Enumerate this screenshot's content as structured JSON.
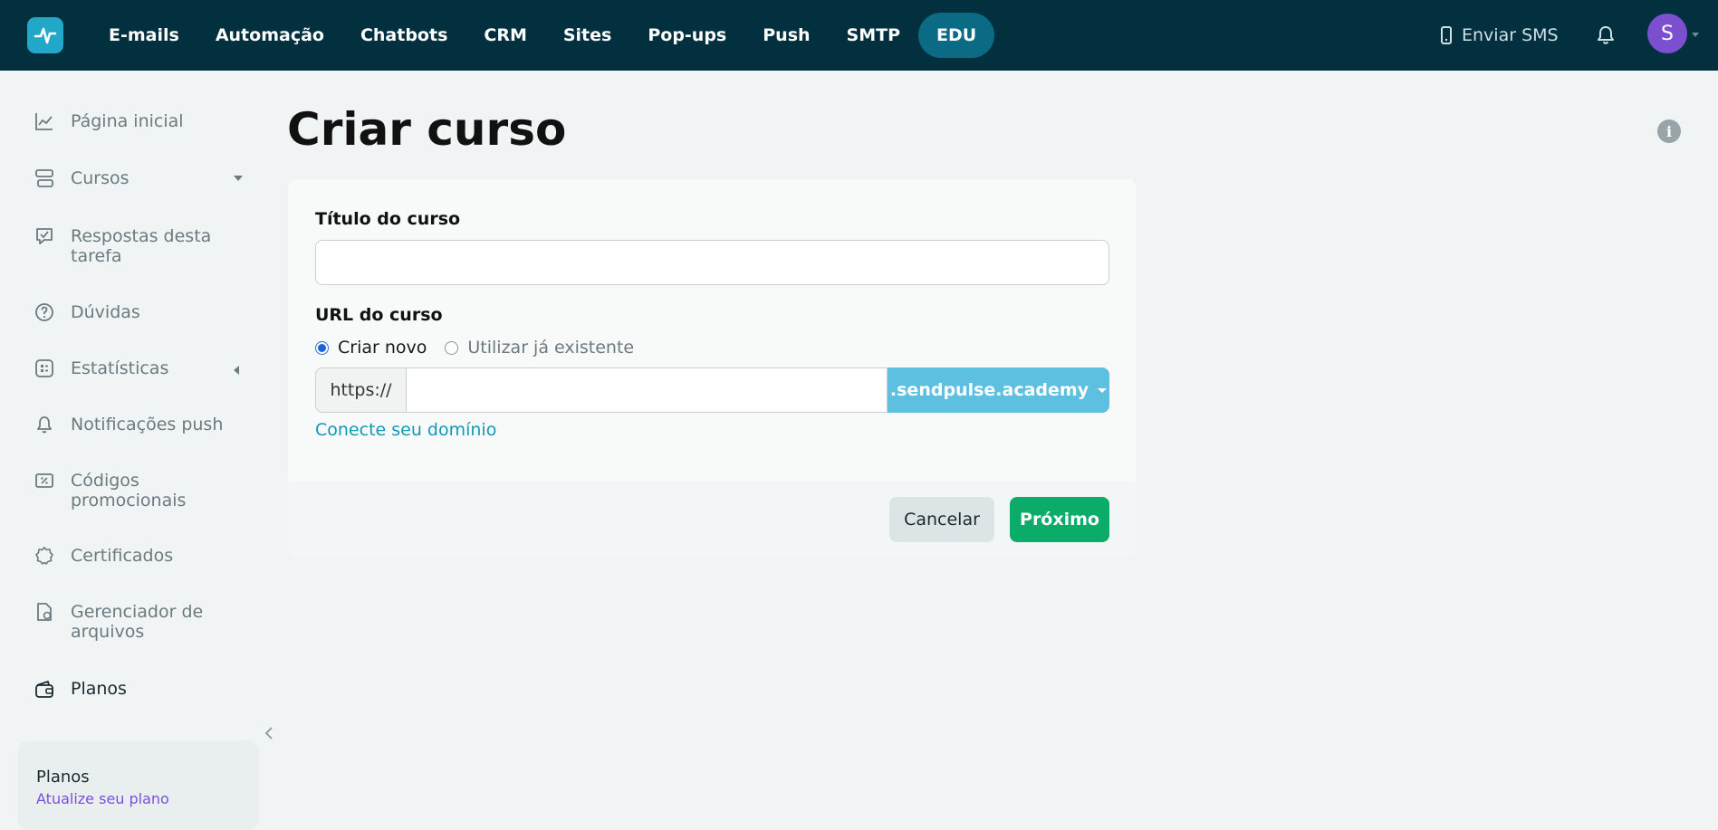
{
  "colors": {
    "topbar": "#03303f",
    "nav_active": "#0b6a84",
    "logo": "#22a7c9",
    "avatar": "#7b4fd0",
    "primary": "#0bab6a",
    "domain_button": "#5ec0e0",
    "link": "#1198b8",
    "plan_link": "#7a4fe0"
  },
  "topbar": {
    "logo_icon": "pulse-icon",
    "nav": [
      {
        "label": "E-mails"
      },
      {
        "label": "Automação"
      },
      {
        "label": "Chatbots"
      },
      {
        "label": "CRM"
      },
      {
        "label": "Sites"
      },
      {
        "label": "Pop-ups"
      },
      {
        "label": "Push"
      },
      {
        "label": "SMTP"
      },
      {
        "label": "EDU",
        "active": true
      }
    ],
    "sms_label": "Enviar SMS",
    "sms_icon": "phone-icon",
    "bell_icon": "bell-icon",
    "avatar_letter": "S"
  },
  "sidebar": {
    "items": [
      {
        "label": "Página inicial",
        "icon": "chart-line-icon"
      },
      {
        "label": "Cursos",
        "icon": "layers-icon",
        "caret": "down"
      },
      {
        "label": "Respostas desta tarefa",
        "icon": "answers-icon"
      },
      {
        "label": "Dúvidas",
        "icon": "question-icon"
      },
      {
        "label": "Estatísticas",
        "icon": "stats-icon",
        "caret": "left"
      },
      {
        "label": "Notificações push",
        "icon": "bell-icon"
      },
      {
        "label": "Códigos promocionais",
        "icon": "coupon-icon"
      },
      {
        "label": "Certificados",
        "icon": "badge-icon"
      },
      {
        "label": "Gerenciador de arquivos",
        "icon": "file-manager-icon"
      },
      {
        "label": "Planos",
        "icon": "wallet-icon",
        "current": true
      }
    ],
    "plan_card": {
      "title": "Planos",
      "subtitle": "Atualize seu plano"
    }
  },
  "main": {
    "title": "Criar curso",
    "form": {
      "course_title_label": "Título do curso",
      "course_title_value": "",
      "url_label": "URL do curso",
      "radio_new": "Criar novo",
      "radio_existing": "Utilizar já existente",
      "radio_selected": "Criar novo",
      "url_prefix": "https://",
      "url_value": "",
      "domain": ".sendpulse.academy",
      "connect_domain_link": "Conecte seu domínio",
      "cancel_label": "Cancelar",
      "next_label": "Próximo"
    }
  }
}
